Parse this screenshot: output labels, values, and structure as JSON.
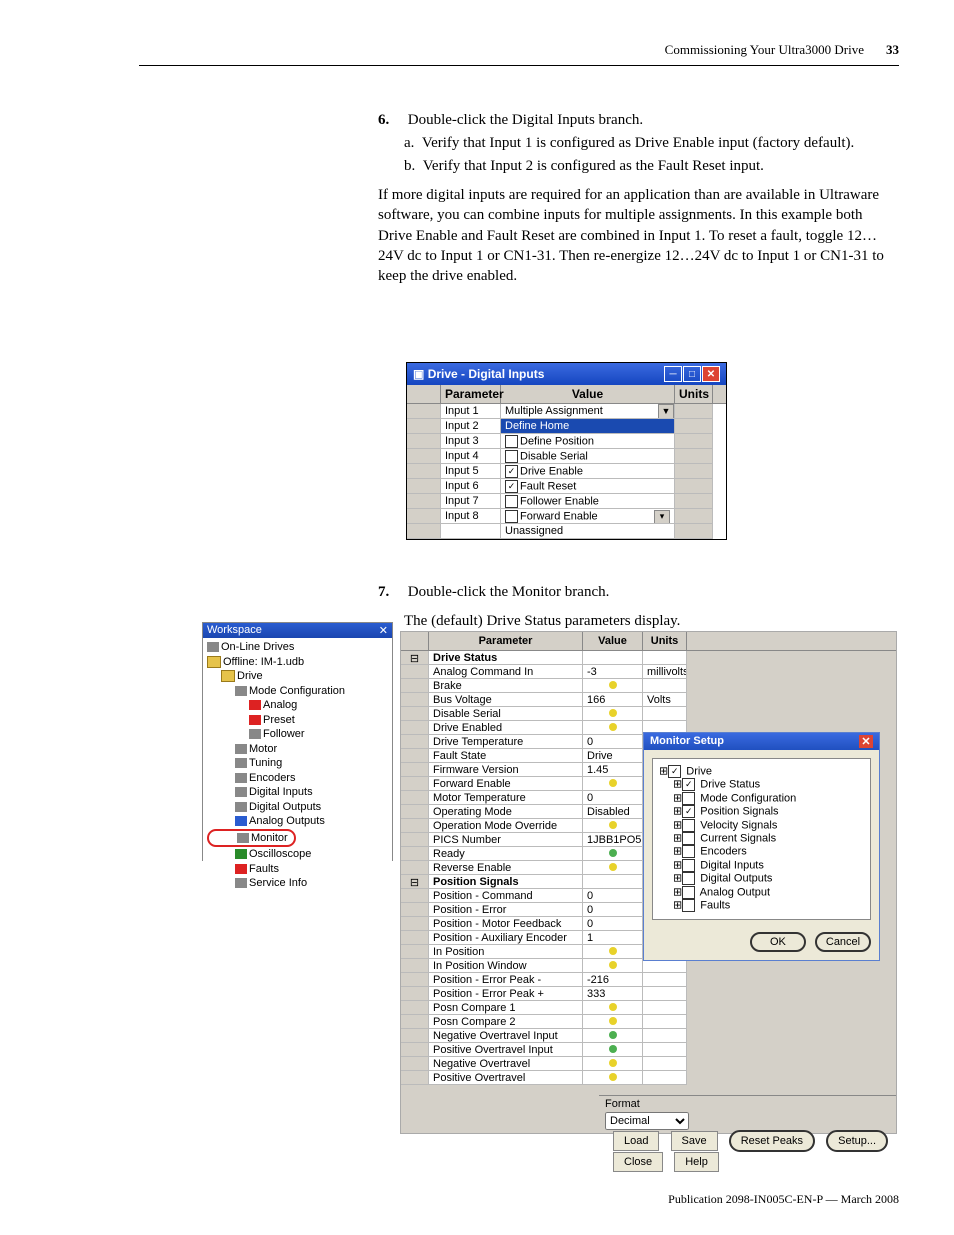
{
  "header": {
    "section": "Commissioning Your Ultra3000 Drive",
    "page": "33"
  },
  "step6": {
    "num": "6.",
    "text": "Double-click the Digital Inputs branch.",
    "a": "Verify that Input 1 is configured as Drive Enable input (factory default).",
    "b": "Verify that Input 2 is configured as the Fault Reset input.",
    "para": "If more digital inputs are required for an application than are available in Ultraware software, you can combine inputs for multiple assignments. In this example both Drive Enable and Fault Reset are combined in Input 1. To reset a fault, toggle 12…24V dc to Input 1 or CN1-31. Then re-energize 12…24V dc to Input 1 or CN1-31 to keep the drive enabled."
  },
  "dlg1": {
    "title": "Drive - Digital Inputs",
    "cols": {
      "param": "Parameter",
      "value": "Value",
      "units": "Units"
    },
    "rows": [
      {
        "p": "Input 1",
        "v": "Multiple Assignment",
        "dd": true
      },
      {
        "p": "Input 2",
        "v": "Define Home",
        "sel": true
      },
      {
        "p": "Input 3",
        "v": "Define Position",
        "chk": false
      },
      {
        "p": "Input 4",
        "v": "Disable Serial Communications",
        "chk": false
      },
      {
        "p": "Input 5",
        "v": "Drive Enable",
        "chk": true
      },
      {
        "p": "Input 6",
        "v": "Fault Reset",
        "chk": true
      },
      {
        "p": "Input 7",
        "v": "Follower Enable",
        "chk": false
      },
      {
        "p": "Input 8",
        "v": "Forward Enable",
        "chk": false,
        "scroll": true
      },
      {
        "p": "",
        "v": "Unassigned",
        "plain": true
      }
    ]
  },
  "step7": {
    "num": "7.",
    "text": "Double-click the Monitor branch.",
    "para": "The (default) Drive Status parameters display."
  },
  "workspace": {
    "title": "Workspace",
    "tree": [
      {
        "lvl": 0,
        "t": "On-Line Drives",
        "ic": "gray"
      },
      {
        "lvl": 0,
        "t": "Offline: IM-1.udb",
        "ic": "folder"
      },
      {
        "lvl": 1,
        "t": "Drive",
        "ic": "folder"
      },
      {
        "lvl": 2,
        "t": "Mode Configuration",
        "ic": "gray"
      },
      {
        "lvl": 3,
        "t": "Analog",
        "ic": "red"
      },
      {
        "lvl": 3,
        "t": "Preset",
        "ic": "red"
      },
      {
        "lvl": 3,
        "t": "Follower",
        "ic": "gray"
      },
      {
        "lvl": 2,
        "t": "Motor",
        "ic": "gray"
      },
      {
        "lvl": 2,
        "t": "Tuning",
        "ic": "gray"
      },
      {
        "lvl": 2,
        "t": "Encoders",
        "ic": "gray"
      },
      {
        "lvl": 2,
        "t": "Digital Inputs",
        "ic": "gray"
      },
      {
        "lvl": 2,
        "t": "Digital Outputs",
        "ic": "gray"
      },
      {
        "lvl": 2,
        "t": "Analog Outputs",
        "ic": "blue"
      },
      {
        "lvl": 2,
        "t": "Monitor",
        "ic": "gray",
        "sel": true
      },
      {
        "lvl": 2,
        "t": "Oscilloscope",
        "ic": "green"
      },
      {
        "lvl": 2,
        "t": "Faults",
        "ic": "red"
      },
      {
        "lvl": 2,
        "t": "Service Info",
        "ic": "gray"
      }
    ]
  },
  "grid": {
    "cols": {
      "param": "Parameter",
      "value": "Value",
      "units": "Units"
    },
    "rows": [
      {
        "grp": true,
        "p": "Drive Status"
      },
      {
        "p": "Analog Command In",
        "v": "-3",
        "u": "millivolts"
      },
      {
        "p": "Brake",
        "v": "",
        "bulb": "y"
      },
      {
        "p": "Bus Voltage",
        "v": "166",
        "u": "Volts"
      },
      {
        "p": "Disable Serial Communications",
        "v": "",
        "bulb": "y"
      },
      {
        "p": "Drive Enabled",
        "v": "",
        "bulb": "y"
      },
      {
        "p": "Drive Temperature",
        "v": "0"
      },
      {
        "p": "Fault State",
        "v": "Drive Ready"
      },
      {
        "p": "Firmware Version",
        "v": "1.45"
      },
      {
        "p": "Forward Enable",
        "v": "",
        "bulb": "y"
      },
      {
        "p": "Motor Temperature",
        "v": "0"
      },
      {
        "p": "Operating Mode",
        "v": "Disabled"
      },
      {
        "p": "Operation Mode Override",
        "v": "",
        "bulb": "y"
      },
      {
        "p": "PICS Number",
        "v": "1JBB1PO5"
      },
      {
        "p": "Ready",
        "v": "",
        "bulb": "g"
      },
      {
        "p": "Reverse Enable",
        "v": "",
        "bulb": "y"
      },
      {
        "grp": true,
        "p": "Position Signals"
      },
      {
        "p": "Position - Command",
        "v": "0"
      },
      {
        "p": "Position - Error",
        "v": "0"
      },
      {
        "p": "Position - Motor Feedback",
        "v": "0"
      },
      {
        "p": "Position - Auxiliary Encoder",
        "v": "1"
      },
      {
        "p": "In Position",
        "v": "",
        "bulb": "y"
      },
      {
        "p": "In Position Window",
        "v": "",
        "bulb": "y"
      },
      {
        "p": "Position - Error Peak -",
        "v": "-216"
      },
      {
        "p": "Position - Error Peak +",
        "v": "333"
      },
      {
        "p": "Posn Compare 1",
        "v": "",
        "bulb": "y"
      },
      {
        "p": "Posn Compare 2",
        "v": "",
        "bulb": "y"
      },
      {
        "p": "Negative Overtravel Input",
        "v": "",
        "bulb": "g"
      },
      {
        "p": "Positive Overtravel Input",
        "v": "",
        "bulb": "g"
      },
      {
        "p": "Negative Overtravel",
        "v": "",
        "bulb": "y"
      },
      {
        "p": "Positive Overtravel",
        "v": "",
        "bulb": "y"
      }
    ]
  },
  "monitorSetup": {
    "title": "Monitor Setup",
    "tree": [
      {
        "lvl": 0,
        "t": "Drive",
        "chk": true
      },
      {
        "lvl": 1,
        "t": "Drive Status",
        "chk": true
      },
      {
        "lvl": 1,
        "t": "Mode Configuration",
        "chk": false
      },
      {
        "lvl": 1,
        "t": "Position Signals",
        "chk": true
      },
      {
        "lvl": 1,
        "t": "Velocity Signals",
        "chk": false
      },
      {
        "lvl": 1,
        "t": "Current Signals",
        "chk": false
      },
      {
        "lvl": 1,
        "t": "Encoders",
        "chk": false
      },
      {
        "lvl": 1,
        "t": "Digital Inputs",
        "chk": false
      },
      {
        "lvl": 1,
        "t": "Digital Outputs",
        "chk": false
      },
      {
        "lvl": 1,
        "t": "Analog Output",
        "chk": false
      },
      {
        "lvl": 1,
        "t": "Faults",
        "chk": false
      }
    ],
    "ok": "OK",
    "cancel": "Cancel"
  },
  "bottomBar": {
    "formatLabel": "Format",
    "formatValue": "Decimal",
    "load": "Load",
    "save": "Save",
    "resetPeaks": "Reset Peaks",
    "setup": "Setup...",
    "close": "Close",
    "help": "Help"
  },
  "footer": "Publication 2098-IN005C-EN-P — March 2008"
}
